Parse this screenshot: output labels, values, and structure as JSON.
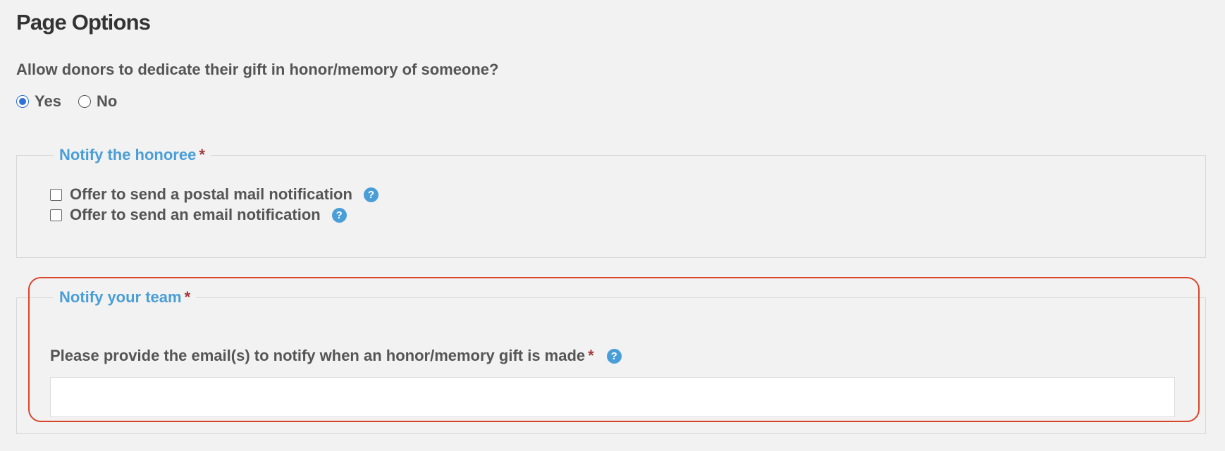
{
  "page_title": "Page Options",
  "dedication": {
    "question": "Allow donors to dedicate their gift in honor/memory of someone?",
    "options": [
      {
        "label": "Yes",
        "checked": true
      },
      {
        "label": "No",
        "checked": false
      }
    ]
  },
  "honoree_section": {
    "legend": "Notify the honoree",
    "required_mark": "*",
    "options": [
      {
        "label": "Offer to send a postal mail notification",
        "checked": false
      },
      {
        "label": "Offer to send an email notification",
        "checked": false
      }
    ]
  },
  "team_section": {
    "legend": "Notify your team",
    "required_mark": "*",
    "email_label": "Please provide the email(s) to notify when an honor/memory gift is made",
    "email_value": "",
    "email_placeholder": ""
  },
  "help_icon_glyph": "?",
  "colors": {
    "accent_blue": "#4a9ed8",
    "required_red": "#a33a3a",
    "highlight_border": "#d9452b",
    "radio_selected": "#2f6fd6"
  }
}
